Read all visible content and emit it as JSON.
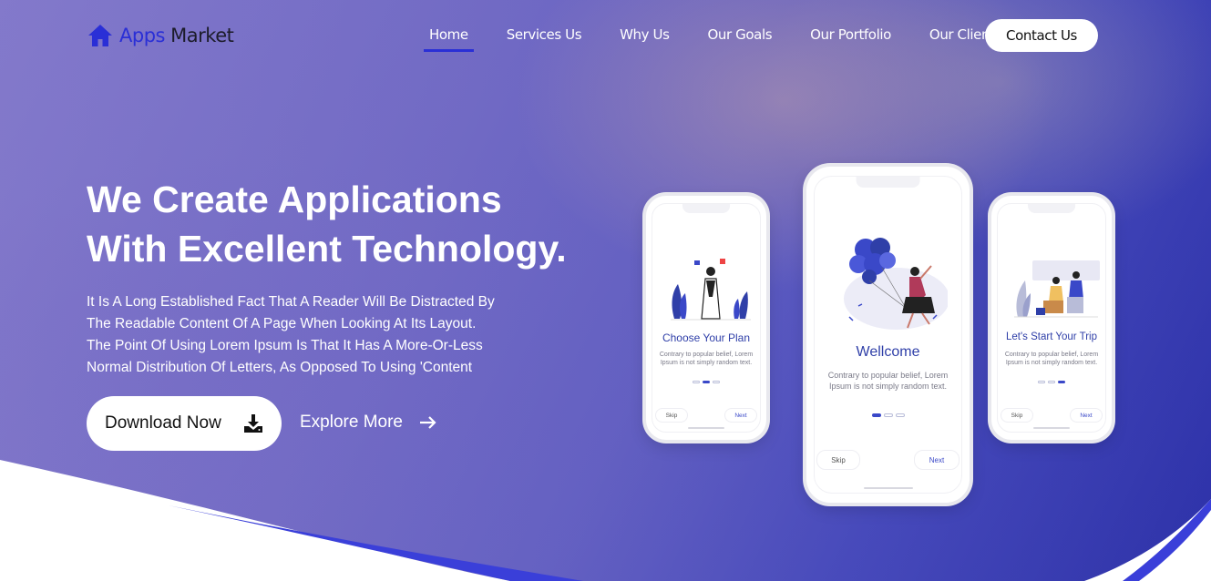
{
  "brand": {
    "apps": "Apps",
    "market": "Market",
    "icon": "home-icon"
  },
  "nav": {
    "items": [
      {
        "label": "Home",
        "active": true
      },
      {
        "label": "Services Us"
      },
      {
        "label": "Why Us"
      },
      {
        "label": "Our Goals"
      },
      {
        "label": "Our Portfolio"
      },
      {
        "label": "Our Client"
      }
    ],
    "contact_label": "Contact Us"
  },
  "hero": {
    "headline_line1": "We Create Applications",
    "headline_line2": "With Excellent Technology.",
    "desc_lines": [
      "It Is A Long Established Fact That A Reader Will Be Distracted By",
      "The Readable Content Of A Page When Looking At Its Layout.",
      "The Point Of Using Lorem Ipsum Is That It Has A More-Or-Less",
      "Normal Distribution Of Letters, As Opposed To Using 'Content"
    ],
    "download_label": "Download Now",
    "download_icon": "download-icon",
    "explore_label": "Explore More",
    "explore_icon": "arrow-right-icon"
  },
  "phones": {
    "left": {
      "title": "Choose Your Plan",
      "body_line1": "Contrary to popular belief, Lorem",
      "body_line2": "Ipsum is not simply random text.",
      "skip": "Skip",
      "next": "Next",
      "active_dot": 2
    },
    "center": {
      "title": "Wellcome",
      "body_line1": "Contrary to popular belief, Lorem",
      "body_line2": "Ipsum is not simply random text.",
      "skip": "Skip",
      "next": "Next",
      "active_dot": 1
    },
    "right": {
      "title": "Let's Start Your Trip",
      "body_line1": "Contrary to popular belief, Lorem",
      "body_line2": "Ipsum is not simply random text.",
      "skip": "Skip",
      "next": "Next",
      "active_dot": 3
    }
  },
  "colors": {
    "accent": "#2a2fd6",
    "phone_title": "#2f3fa8",
    "hero_overlay": "#6c69c6"
  }
}
